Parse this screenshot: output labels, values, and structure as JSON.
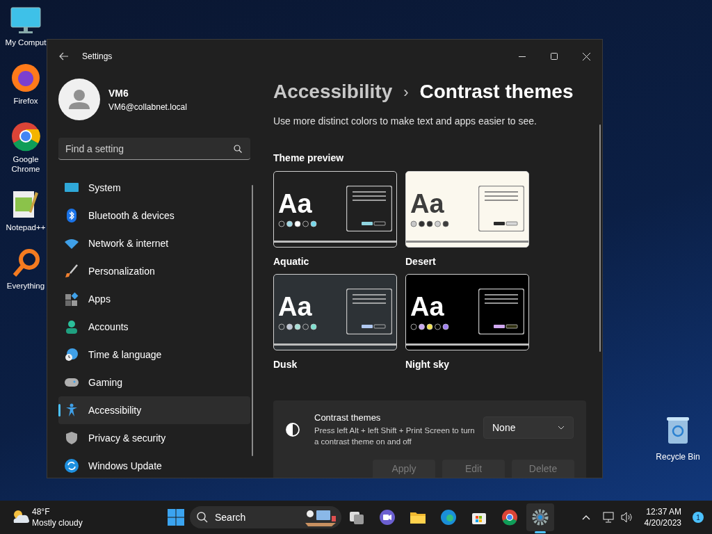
{
  "desktop_icons": [
    {
      "kind": "computer",
      "label": "My Comput"
    },
    {
      "kind": "firefox",
      "label": "Firefox"
    },
    {
      "kind": "chrome",
      "label": "Google Chrome"
    },
    {
      "kind": "notepad",
      "label": "Notepad++"
    },
    {
      "kind": "everything",
      "label": "Everything"
    }
  ],
  "recycle_bin": {
    "label": "Recycle Bin"
  },
  "window": {
    "title": "Settings"
  },
  "user": {
    "name": "VM6",
    "email": "VM6@collabnet.local"
  },
  "search": {
    "placeholder": "Find a setting"
  },
  "nav": [
    {
      "kind": "system",
      "label": "System",
      "selected": false
    },
    {
      "kind": "bluetooth",
      "label": "Bluetooth & devices",
      "selected": false
    },
    {
      "kind": "network",
      "label": "Network & internet",
      "selected": false
    },
    {
      "kind": "brush",
      "label": "Personalization",
      "selected": false
    },
    {
      "kind": "apps",
      "label": "Apps",
      "selected": false
    },
    {
      "kind": "accounts",
      "label": "Accounts",
      "selected": false
    },
    {
      "kind": "time",
      "label": "Time & language",
      "selected": false
    },
    {
      "kind": "gaming",
      "label": "Gaming",
      "selected": false
    },
    {
      "kind": "accessibility",
      "label": "Accessibility",
      "selected": true
    },
    {
      "kind": "privacy",
      "label": "Privacy & security",
      "selected": false
    },
    {
      "kind": "update",
      "label": "Windows Update",
      "selected": false
    }
  ],
  "breadcrumb": {
    "parent": "Accessibility",
    "separator": "›",
    "current": "Contrast themes"
  },
  "description": "Use more distinct colors to make text and apps easier to see.",
  "section_label": "Theme preview",
  "themes": [
    {
      "name": "Aquatic",
      "sample": "Aa",
      "color": "#202020"
    },
    {
      "name": "Desert",
      "sample": "Aa",
      "color": "#fbf8ee"
    },
    {
      "name": "Dusk",
      "sample": "Aa",
      "color": "#2d3236"
    },
    {
      "name": "Night sky",
      "sample": "Aa",
      "color": "#000000"
    }
  ],
  "contrast_setting": {
    "title": "Contrast themes",
    "description": "Press left Alt + left Shift + Print Screen to turn a contrast theme on and off",
    "value": "None"
  },
  "actions": [
    {
      "label": "Apply",
      "disabled": true
    },
    {
      "label": "Edit",
      "disabled": true
    },
    {
      "label": "Delete",
      "disabled": true
    }
  ],
  "taskbar": {
    "temperature": "48°F",
    "condition": "Mostly cloudy",
    "search_label": "Search",
    "apps": [
      {
        "kind": "taskview",
        "active": false
      },
      {
        "kind": "chat",
        "active": false
      },
      {
        "kind": "explorer",
        "active": false
      },
      {
        "kind": "edge",
        "active": false
      },
      {
        "kind": "store",
        "active": false
      },
      {
        "kind": "chrome",
        "active": false
      },
      {
        "kind": "settings",
        "active": true
      }
    ],
    "time": "12:37 AM",
    "date": "4/20/2023",
    "notifications": "1"
  }
}
